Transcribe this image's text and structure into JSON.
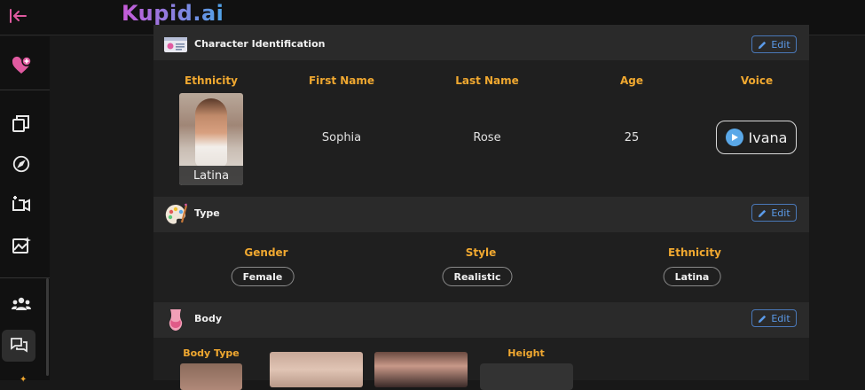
{
  "app": {
    "logo_text": "Kupid.ai"
  },
  "sidebar": {
    "items": [
      {
        "name": "create-character",
        "icon": "add-heart-icon"
      },
      {
        "name": "gallery",
        "icon": "stack-icon"
      },
      {
        "name": "explore",
        "icon": "compass-icon"
      },
      {
        "name": "video",
        "icon": "video-icon"
      },
      {
        "name": "images",
        "icon": "image-sparkle-icon"
      },
      {
        "name": "community",
        "icon": "group-icon"
      },
      {
        "name": "chat",
        "icon": "chat-icon"
      }
    ]
  },
  "sections": {
    "identification": {
      "title": "Character Identification",
      "edit_label": "Edit",
      "columns": {
        "ethnicity_label": "Ethnicity",
        "first_name_label": "First Name",
        "last_name_label": "Last Name",
        "age_label": "Age",
        "voice_label": "Voice"
      },
      "values": {
        "ethnicity": "Latina",
        "first_name": "Sophia",
        "last_name": "Rose",
        "age": "25",
        "voice": "Ivana"
      }
    },
    "type": {
      "title": "Type",
      "edit_label": "Edit",
      "gender_label": "Gender",
      "gender_value": "Female",
      "style_label": "Style",
      "style_value": "Realistic",
      "ethnicity_label": "Ethnicity",
      "ethnicity_value": "Latina"
    },
    "body": {
      "title": "Body",
      "edit_label": "Edit",
      "body_type_label": "Body Type",
      "height_label": "Height"
    }
  },
  "colors": {
    "accent_orange": "#f0a830",
    "edit_blue": "#5b9ae8",
    "brand_pink": "#e05aa0"
  }
}
